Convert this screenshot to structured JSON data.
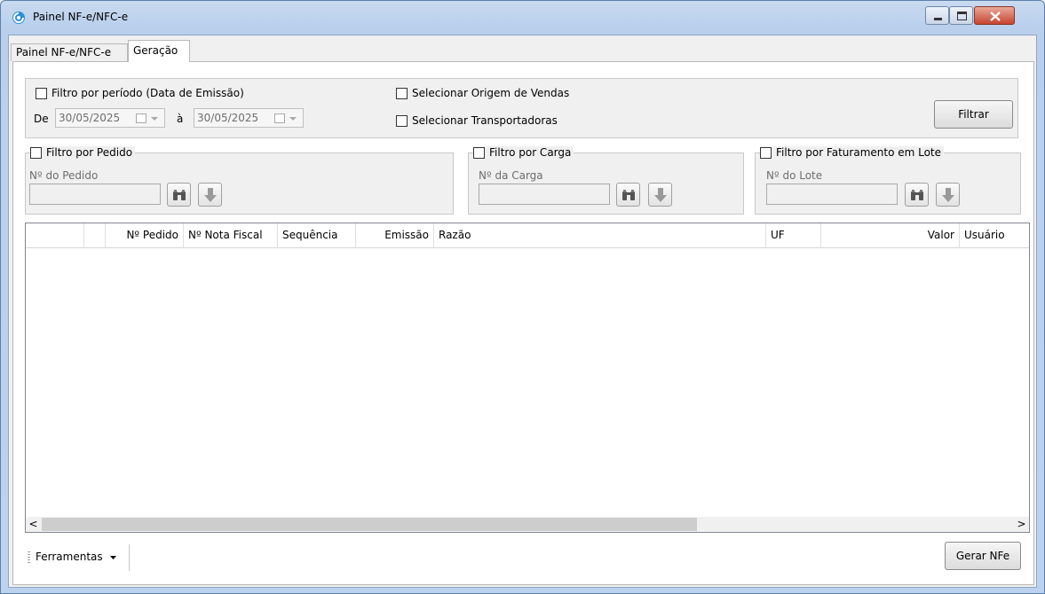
{
  "window": {
    "title": "Painel NF-e/NFC-e"
  },
  "tabs": [
    {
      "label": "Painel NF-e/NFC-e"
    },
    {
      "label": "Geração"
    }
  ],
  "filters": {
    "periodo_label": "Filtro por período (Data de Emissão)",
    "de_label": "De",
    "data_inicio": "30/05/2025",
    "a_label": "à",
    "data_fim": "30/05/2025",
    "origem_label": "Selecionar Origem de Vendas",
    "transportadoras_label": "Selecionar Transportadoras",
    "filtrar_button": "Filtrar"
  },
  "pedido": {
    "legend": "Filtro por Pedido",
    "field_label": "Nº do Pedido",
    "value": ""
  },
  "carga": {
    "legend": "Filtro por Carga",
    "field_label": "Nº da Carga",
    "value": ""
  },
  "lote": {
    "legend": "Filtro por Faturamento em Lote",
    "field_label": "Nº do Lote",
    "value": ""
  },
  "grid": {
    "columns": [
      "",
      "",
      "Nº Pedido",
      "Nº Nota Fiscal",
      "Sequência",
      "Emissão",
      "Razão",
      "UF",
      "Valor",
      "Usuário"
    ],
    "rows": [],
    "scroll_left": "<",
    "scroll_right": ">"
  },
  "footer": {
    "ferramentas": "Ferramentas",
    "gerar_button": "Gerar NFe"
  },
  "colors": {
    "title_bar": "#bcd2ee",
    "close_button": "#c7442f"
  }
}
